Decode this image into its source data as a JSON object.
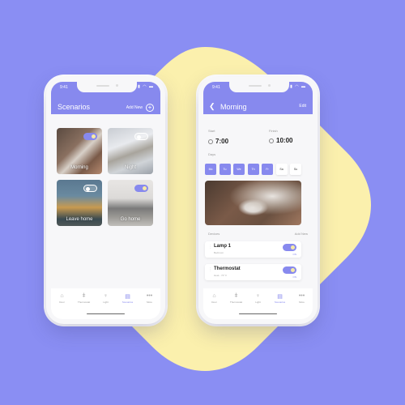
{
  "colors": {
    "background": "#8a8ef3",
    "blob": "#fbf0ad",
    "accent": "#8789ee",
    "toggle_knob": "#f5e9a5"
  },
  "status_bar": {
    "time": "9:41",
    "icons": "signal wifi battery"
  },
  "scenarios_screen": {
    "title": "Scenarios",
    "add_new_label": "Add New",
    "add_icon": "plus-circle-icon",
    "cards": [
      {
        "label": "Morning",
        "toggle": "on"
      },
      {
        "label": "Night",
        "toggle": "off"
      },
      {
        "label": "Leave home",
        "toggle": "off",
        "state_text": "OFF"
      },
      {
        "label": "Go home",
        "toggle": "on"
      }
    ]
  },
  "morning_screen": {
    "back_icon": "chevron-left-icon",
    "title": "Morning",
    "edit_label": "Edit",
    "start_label": "Start",
    "start_time": "7:00",
    "finish_label": "Finish",
    "finish_time": "10:00",
    "days_label": "Days",
    "days": [
      {
        "label": "Mo",
        "selected": true
      },
      {
        "label": "Tu",
        "selected": true
      },
      {
        "label": "We",
        "selected": true
      },
      {
        "label": "Th",
        "selected": true
      },
      {
        "label": "Fr",
        "selected": true
      },
      {
        "label": "Sa",
        "selected": false
      },
      {
        "label": "Su",
        "selected": false
      }
    ],
    "devices_label": "Devices",
    "devices_add_new": "Add New",
    "devices": [
      {
        "name": "Lamp 1",
        "subtitle": "Bedroom",
        "state": "ON"
      },
      {
        "name": "Thermostat",
        "subtitle": "Heat - 72° F",
        "state": "ON"
      }
    ]
  },
  "tabbar": {
    "items": [
      {
        "label": "Door",
        "icon": "lock-icon",
        "glyph": "🔒",
        "active": false
      },
      {
        "label": "Thermostat",
        "icon": "thermometer-icon",
        "glyph": "🌡",
        "active": false
      },
      {
        "label": "Light",
        "icon": "lightbulb-icon",
        "glyph": "💡",
        "active": false
      },
      {
        "label": "Scenarios",
        "icon": "scenarios-icon",
        "glyph": "▦",
        "active": true
      },
      {
        "label": "More",
        "icon": "more-icon",
        "glyph": "•••",
        "active": false
      }
    ]
  }
}
